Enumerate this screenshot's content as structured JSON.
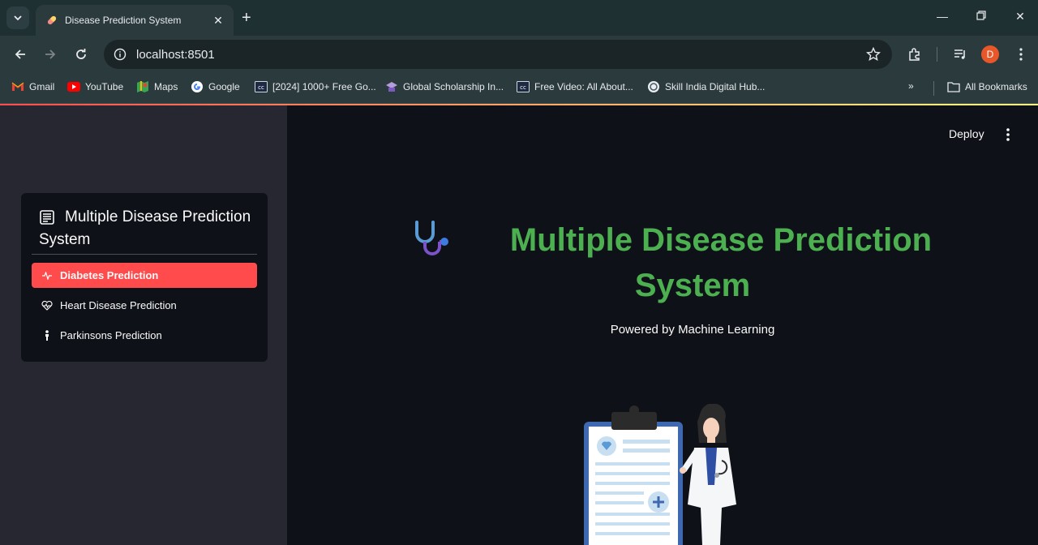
{
  "browser": {
    "tab_title": "Disease Prediction System",
    "url": "localhost:8501",
    "profile_initial": "D",
    "bookmarks": [
      {
        "label": "Gmail",
        "icon": "gmail-icon"
      },
      {
        "label": "YouTube",
        "icon": "youtube-icon"
      },
      {
        "label": "Maps",
        "icon": "maps-icon"
      },
      {
        "label": "Google",
        "icon": "google-icon"
      },
      {
        "label": "[2024] 1000+ Free Go...",
        "icon": "cc-icon"
      },
      {
        "label": "Global Scholarship In...",
        "icon": "scholarship-icon"
      },
      {
        "label": "Free Video: All About...",
        "icon": "cc-icon"
      },
      {
        "label": "Skill India Digital Hub...",
        "icon": "skill-india-icon"
      }
    ],
    "all_bookmarks": "All Bookmarks",
    "accent": "#ff4b4b"
  },
  "sidebar": {
    "menu_title": "Multiple Disease Prediction System",
    "items": [
      {
        "label": "Diabetes Prediction",
        "icon": "activity-icon",
        "active": true
      },
      {
        "label": "Heart Disease Prediction",
        "icon": "heart-pulse-icon",
        "active": false
      },
      {
        "label": "Parkinsons Prediction",
        "icon": "person-icon",
        "active": false
      }
    ]
  },
  "header": {
    "deploy_label": "Deploy"
  },
  "main": {
    "title": "Multiple Disease Prediction System",
    "title_color": "#4caf50",
    "subtitle": "Powered by Machine Learning",
    "hero_icon": "stethoscope-icon",
    "illustration": "doctor-with-clipboard"
  }
}
